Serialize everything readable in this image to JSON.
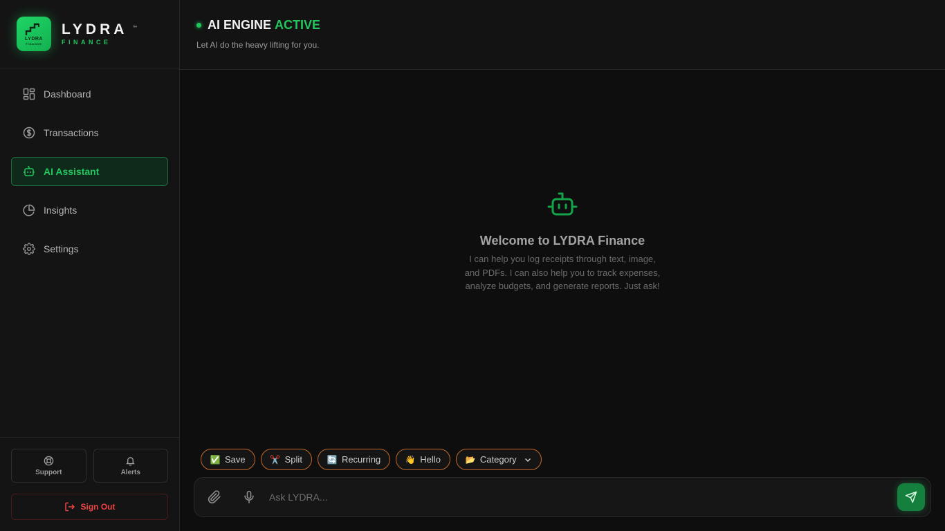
{
  "brand": {
    "name": "LYDRA",
    "tm": "™",
    "sub": "FINANCE",
    "logo_mini": "LYDRA",
    "logo_mini_sub": "FINANCE"
  },
  "nav": {
    "items": [
      {
        "label": "Dashboard",
        "icon": "dashboard-icon"
      },
      {
        "label": "Transactions",
        "icon": "dollar-circle-icon"
      },
      {
        "label": "AI Assistant",
        "icon": "bot-icon",
        "active": true
      },
      {
        "label": "Insights",
        "icon": "pie-chart-icon"
      },
      {
        "label": "Settings",
        "icon": "gear-icon"
      }
    ]
  },
  "sidebar_bottom": {
    "support_label": "Support",
    "alerts_label": "Alerts",
    "signout_label": "Sign Out"
  },
  "header": {
    "title_main": "AI ENGINE",
    "title_accent": "ACTIVE",
    "subtitle": "Let AI do the heavy lifting for you."
  },
  "welcome": {
    "title": "Welcome to LYDRA Finance",
    "text": "I can help you log receipts through text, image, and PDFs. I can also help you to track expenses, analyze budgets, and generate reports. Just ask!"
  },
  "chips": [
    {
      "label": "Save",
      "emoji": "✅"
    },
    {
      "label": "Split",
      "emoji": "✂️"
    },
    {
      "label": "Recurring",
      "emoji": "🔄"
    },
    {
      "label": "Hello",
      "emoji": "👋"
    },
    {
      "label": "Category",
      "emoji": "📂"
    }
  ],
  "composer": {
    "placeholder": "Ask LYDRA..."
  },
  "colors": {
    "accent": "#22c55e",
    "danger": "#ef4444",
    "chip_border": "#c2692a",
    "background": "#0e0e0e"
  }
}
